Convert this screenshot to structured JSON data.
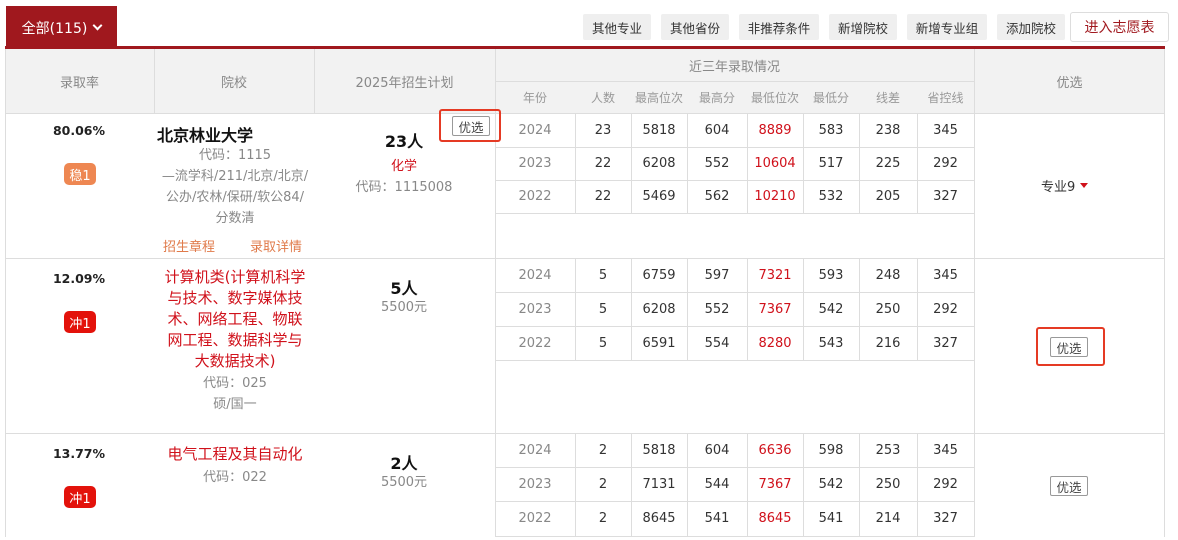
{
  "toolbar": {
    "all_tab": "全部(115)",
    "buttons": [
      "其他专业",
      "其他省份",
      "非推荐条件",
      "新增院校",
      "新增专业组",
      "添加院校"
    ],
    "enter": "进入志愿表"
  },
  "header": {
    "rate": "录取率",
    "school": "院校",
    "plan": "2025年招生计划",
    "history": "近三年录取情况",
    "pick": "优选",
    "sub": [
      "年份",
      "人数",
      "最高位次",
      "最高分",
      "最低位次",
      "最低分",
      "线差",
      "省控线"
    ]
  },
  "rows": [
    {
      "rate": "80.06%",
      "badge": "稳1",
      "school_name": "北京林业大学",
      "code": "代码：1115",
      "tags": [
        "—流学科/211/北京/北京/",
        "公办/农林/保研/软公84/",
        "分数清"
      ],
      "link1": "招生章程",
      "link2": "录取详情",
      "plan_num": "23人",
      "plan_subject": "化学",
      "plan_code": "代码：1115008",
      "pick_inline": "优选",
      "major_sel": "专业9",
      "history": [
        [
          "2024",
          "23",
          "5818",
          "604",
          "8889",
          "583",
          "238",
          "345"
        ],
        [
          "2023",
          "22",
          "6208",
          "552",
          "10604",
          "517",
          "225",
          "292"
        ],
        [
          "2022",
          "22",
          "5469",
          "562",
          "10210",
          "532",
          "205",
          "327"
        ]
      ]
    },
    {
      "rate": "12.09%",
      "badge": "冲1",
      "major_lines": [
        "计算机类(计算机科学",
        "与技术、数字媒体技",
        "术、网络工程、物联",
        "网工程、数据科学与",
        "大数据技术)"
      ],
      "code": "代码：025",
      "note": "硕/国一",
      "plan_num": "5人",
      "plan_fee": "5500元",
      "pick": "优选",
      "history": [
        [
          "2024",
          "5",
          "6759",
          "597",
          "7321",
          "593",
          "248",
          "345"
        ],
        [
          "2023",
          "5",
          "6208",
          "552",
          "7367",
          "542",
          "250",
          "292"
        ],
        [
          "2022",
          "5",
          "6591",
          "554",
          "8280",
          "543",
          "216",
          "327"
        ]
      ]
    },
    {
      "rate": "13.77%",
      "badge": "冲1",
      "major_lines": [
        "电气工程及其自动化"
      ],
      "code": "代码：022",
      "plan_num": "2人",
      "plan_fee": "5500元",
      "pick": "优选",
      "history": [
        [
          "2024",
          "2",
          "5818",
          "604",
          "6636",
          "598",
          "253",
          "345"
        ],
        [
          "2023",
          "2",
          "7131",
          "544",
          "7367",
          "542",
          "250",
          "292"
        ],
        [
          "2022",
          "2",
          "8645",
          "541",
          "8645",
          "541",
          "214",
          "327"
        ]
      ]
    }
  ],
  "colors": {
    "brand": "#a0181e",
    "accent_red": "#d0111b",
    "badge_orange": "#ee8752",
    "badge_red": "#e3120b",
    "highlight": "#e53a24"
  }
}
